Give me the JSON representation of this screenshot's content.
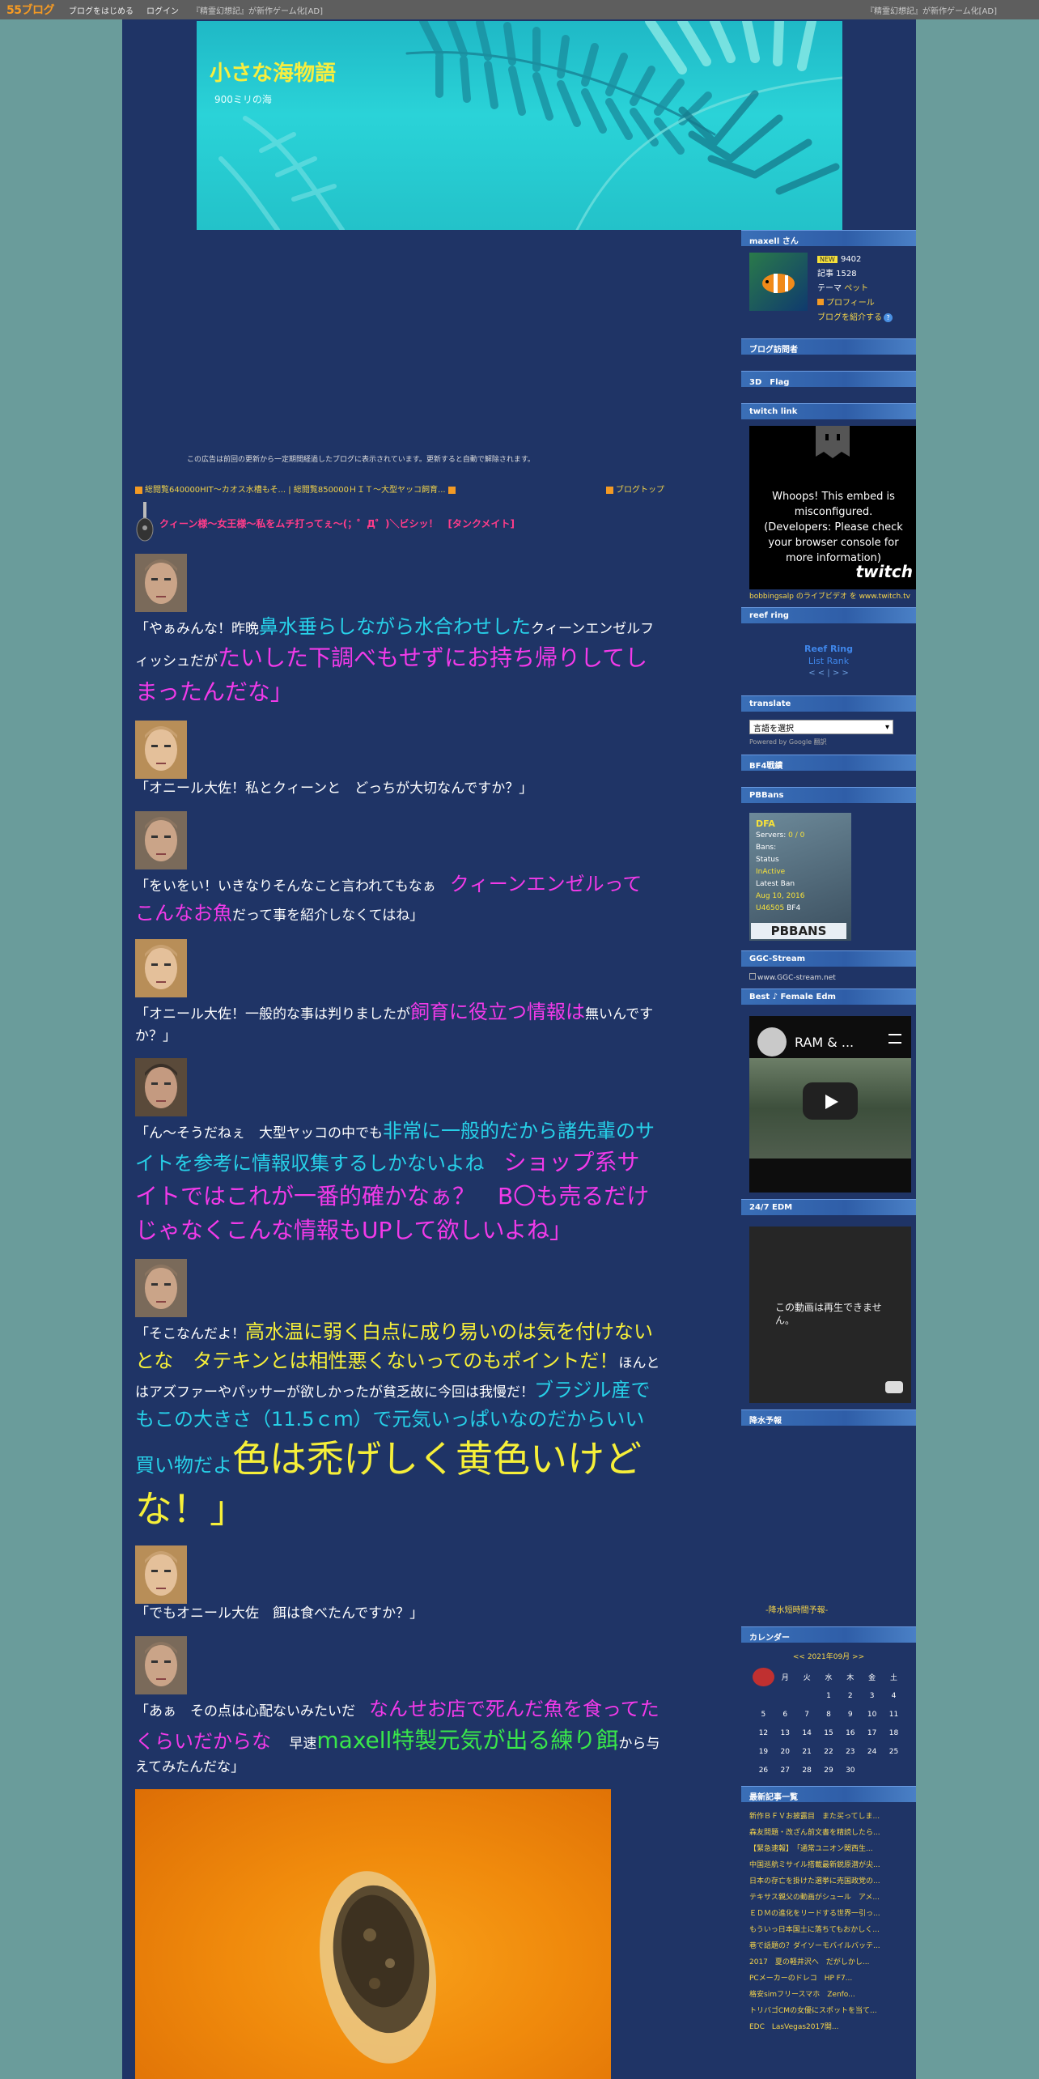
{
  "topbar": {
    "logo": "55ブログ",
    "start_blog": "ブログをはじめる",
    "login": "ログイン",
    "ad_left": "『精霊幻想記』が新作ゲーム化[AD]",
    "ad_right": "『精霊幻想記』が新作ゲーム化[AD]"
  },
  "blog": {
    "title": "小さな海物語",
    "subtitle": "900ミリの海"
  },
  "notice": "この広告は前回の更新から一定期間経過したブログに表示されています。更新すると自動で解除されます。",
  "crumbs": {
    "prev": "総閲覧640000HIT～カオス水槽もそ...",
    "sep": "|",
    "next": "総閲覧850000ＨＩＴ～大型ヤッコ飼育...",
    "top": "ブログトップ"
  },
  "entry_title": "クィーン様～女王様～私をムチ打ってぇ～(；゜Д゜)＼ビシッ！　[タンクメイト]",
  "paras": [
    {
      "who": "oneill",
      "segs": [
        [
          "w",
          "「やぁみんな！昨晩"
        ],
        [
          "c",
          "鼻水垂らしながら水合わせした"
        ],
        [
          "w",
          "クィーンエンゼルフィッシュだが"
        ],
        [
          "mb",
          "たいした下調べもせずにお持ち帰りしてしまったんだな"
        ],
        [
          "mb",
          "」"
        ]
      ]
    },
    {
      "who": "carter",
      "segs": [
        [
          "w",
          "「オニール大佐！私とクィーンと　どっちが大切なんですか？」"
        ]
      ]
    },
    {
      "who": "oneill",
      "segs": [
        [
          "w",
          "「をいをい！いきなりそんなこと言われてもなぁ　"
        ],
        [
          "mx",
          "クィーンエンゼルってこんなお魚"
        ],
        [
          "w",
          "だって事を紹介しなくてはね」"
        ]
      ]
    },
    {
      "who": "carter",
      "segs": [
        [
          "w",
          "「オニール大佐！一般的な事は判りましたが"
        ],
        [
          "mx",
          "飼育に役立つ情報は"
        ],
        [
          "w",
          "無いんですか？」"
        ]
      ]
    },
    {
      "who": "daniel",
      "segs": [
        [
          "w",
          "「ん～そうだねぇ　大型ヤッコの中でも"
        ],
        [
          "cx",
          "非常に一般的だから諸先輩のサイトを参考に情報収集するしかないよね　"
        ],
        [
          "mb",
          "ショップ系サイトではこれが一番的確かなぁ？　B〇も売るだけじゃなくこんな情報もUPして欲しいよね」"
        ]
      ]
    },
    {
      "who": "oneill",
      "segs": [
        [
          "w",
          "「そこなんだよ！"
        ],
        [
          "yx",
          "高水温に弱く白点に成り易いのは気を付けないとな　タテキンとは相性悪くないってのもポイントだ！"
        ],
        [
          "w",
          "ほんとはアズファーやパッサーが欲しかったが貧乏故に今回は我慢だ！"
        ],
        [
          "cx",
          "ブラジル産でもこの大きさ（11.5ｃｍ）で元気いっぱいなのだからいい買い物だよ"
        ],
        [
          "yh",
          "色は禿げしく黄色いけどな！」"
        ]
      ]
    },
    {
      "who": "carter",
      "segs": [
        [
          "w",
          "「でもオニール大佐　餌は食べたんですか？」"
        ]
      ]
    },
    {
      "who": "oneill",
      "segs": [
        [
          "w",
          "「あぁ　その点は心配ないみたいだ　"
        ],
        [
          "mx",
          "なんせお店で死んだ魚を食ってたくらいだからな"
        ],
        [
          "w",
          "　 早速"
        ],
        [
          "gb",
          "maxell特製元気が出る練り餌"
        ],
        [
          "w",
          "から与えてみたんだな」"
        ]
      ]
    }
  ],
  "sidebar": {
    "profile_title": "maxell さん",
    "level": "NEW",
    "points": "9402",
    "articles": "記事 1528",
    "theme_label": "テーマ",
    "theme": "ペット",
    "profile_link": "プロフィール",
    "introduce": "ブログを紹介する",
    "visitors_title": "ブログ訪問者",
    "flag_title": "3D　Flag",
    "twitch_title": "twitch link",
    "twitch_msg": "Whoops! This embed is misconfigured. (Developers: Please check your browser console for more information)",
    "twitch_wm": "twitch",
    "twitch_link": "bobbingsalp のライブビデオ を www.twitch.tv",
    "reef_title": "reef ring",
    "reef_name": "Reef Ring",
    "reef_list": "List Rank",
    "reef_nav": "< < | > >",
    "translate_title": "translate",
    "translate_select": "言語を選択",
    "google_powered": "Powered by Google 翻訳",
    "bf4_title": "BF4戦績",
    "pbbans_title": "PBBans",
    "pbb": {
      "name": "DFA",
      "servers_k": "Servers:",
      "servers_v": "0 / 0",
      "bans_k": "Bans:",
      "status_k": "Status",
      "status_v": "InActive",
      "latest_k": "Latest Ban",
      "latest_v": "Aug 10, 2016",
      "id": "U46505",
      "game": "BF4",
      "logo": "PBBANS"
    },
    "ggc_title": "GGC-Stream",
    "ggc_text": "www.GGC-stream.net",
    "edm1_title": "Best ♪ Female Edm",
    "edm1_video": "RAM & ...",
    "edm2_title": "24/7 EDM",
    "edm2_msg": "この動画は再生できません。",
    "rain_title": "降水予報",
    "rain_link": "-降水短時間予報-",
    "cal_title": "カレンダー",
    "cal_head": "<< 2021年09月 >>",
    "cal_days": [
      "日",
      "月",
      "火",
      "水",
      "木",
      "金",
      "土"
    ],
    "cal_weeks": [
      [
        "",
        "",
        "",
        "1",
        "2",
        "3",
        "4"
      ],
      [
        "5",
        "6",
        "7",
        "8",
        "9",
        "10",
        "11"
      ],
      [
        "12",
        "13",
        "14",
        "15",
        "16",
        "17",
        "18"
      ],
      [
        "19",
        "20",
        "21",
        "22",
        "23",
        "24",
        "25"
      ],
      [
        "26",
        "27",
        "28",
        "29",
        "30",
        "",
        ""
      ]
    ],
    "recent_title": "最新記事一覧",
    "recent": [
      "新作ＢＦＶお披露目　また买ってしま...",
      "森友問題・改ざん前文書を精読したら...",
      "【緊急速報】　「通常ユニオン関西生...",
      "中国巡航ミサイル搭載最新鋭原潜が尖...",
      "日本の存亡を掛けた選挙に売国政党の...",
      "テキサス親父の動画がシュール　アメ...",
      "ＥＤＭの進化をリードする世界一引っ...",
      "もういっ日本国土に落ちてもおかしく...",
      "巷で話題の？ダイソーモバイルバッテ...",
      "2017　夏の軽井沢へ　だがしかし...",
      "PCメーカーのドレコ　HP F7...",
      "格安simフリースマホ　Zenfo...",
      "トリバゴCMの女優にスポットを当て...",
      "EDC　LasVegas2017開..."
    ]
  }
}
